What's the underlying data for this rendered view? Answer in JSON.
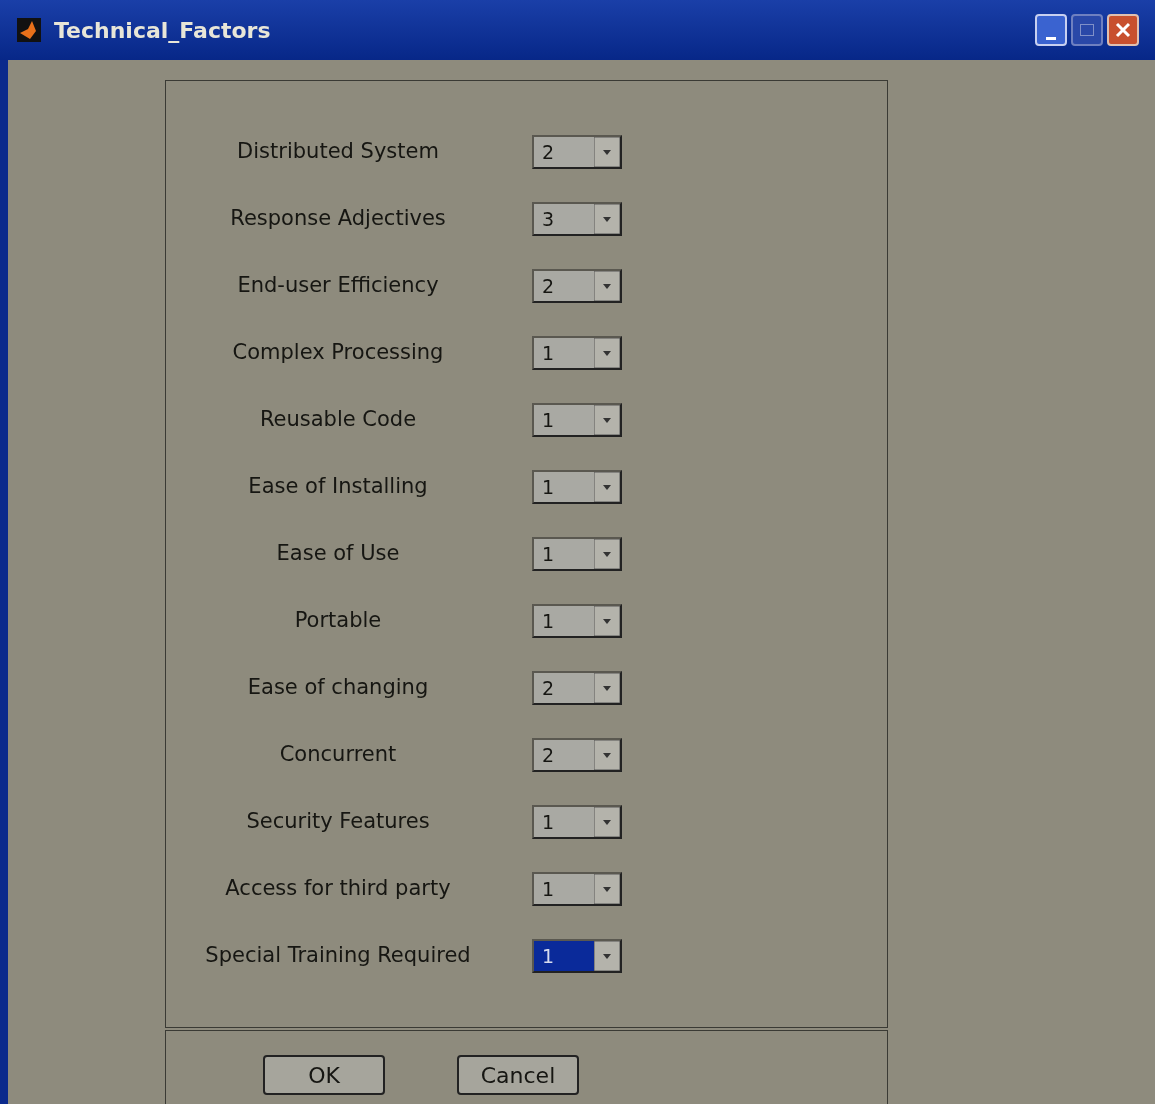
{
  "window": {
    "title": "Technical_Factors"
  },
  "factors": [
    {
      "label": "Distributed System",
      "value": "2",
      "focused": false
    },
    {
      "label": "Response Adjectives",
      "value": "3",
      "focused": false
    },
    {
      "label": "End-user Efficiency",
      "value": "2",
      "focused": false
    },
    {
      "label": "Complex Processing",
      "value": "1",
      "focused": false
    },
    {
      "label": "Reusable Code",
      "value": "1",
      "focused": false
    },
    {
      "label": "Ease of Installing",
      "value": "1",
      "focused": false
    },
    {
      "label": "Ease of Use",
      "value": "1",
      "focused": false
    },
    {
      "label": "Portable",
      "value": "1",
      "focused": false
    },
    {
      "label": "Ease of changing",
      "value": "2",
      "focused": false
    },
    {
      "label": "Concurrent",
      "value": "2",
      "focused": false
    },
    {
      "label": "Security Features",
      "value": "1",
      "focused": false
    },
    {
      "label": "Access for third party",
      "value": "1",
      "focused": false
    },
    {
      "label": "Special Training Required",
      "value": "1",
      "focused": true
    }
  ],
  "buttons": [
    "OK",
    "Cancel"
  ]
}
